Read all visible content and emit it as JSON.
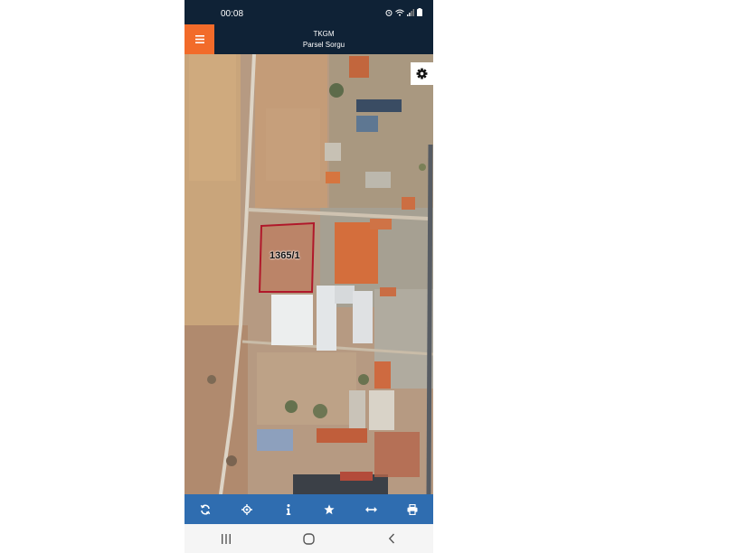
{
  "status_bar": {
    "time": "00:08"
  },
  "app_bar": {
    "title": "TKGM",
    "subtitle": "Parsel Sorgu"
  },
  "map": {
    "parcel_label": "1365/1",
    "parcel_border_color": "#b0182a"
  },
  "toolbar": {
    "icons": [
      "refresh-icon",
      "locate-icon",
      "info-icon",
      "star-icon",
      "measure-icon",
      "print-icon"
    ]
  },
  "nav_bar": {
    "icons": [
      "recents-icon",
      "home-icon",
      "back-icon"
    ]
  },
  "colors": {
    "header": "#0f2236",
    "menu_button": "#f26b2a",
    "toolbar": "#2f6db0"
  }
}
